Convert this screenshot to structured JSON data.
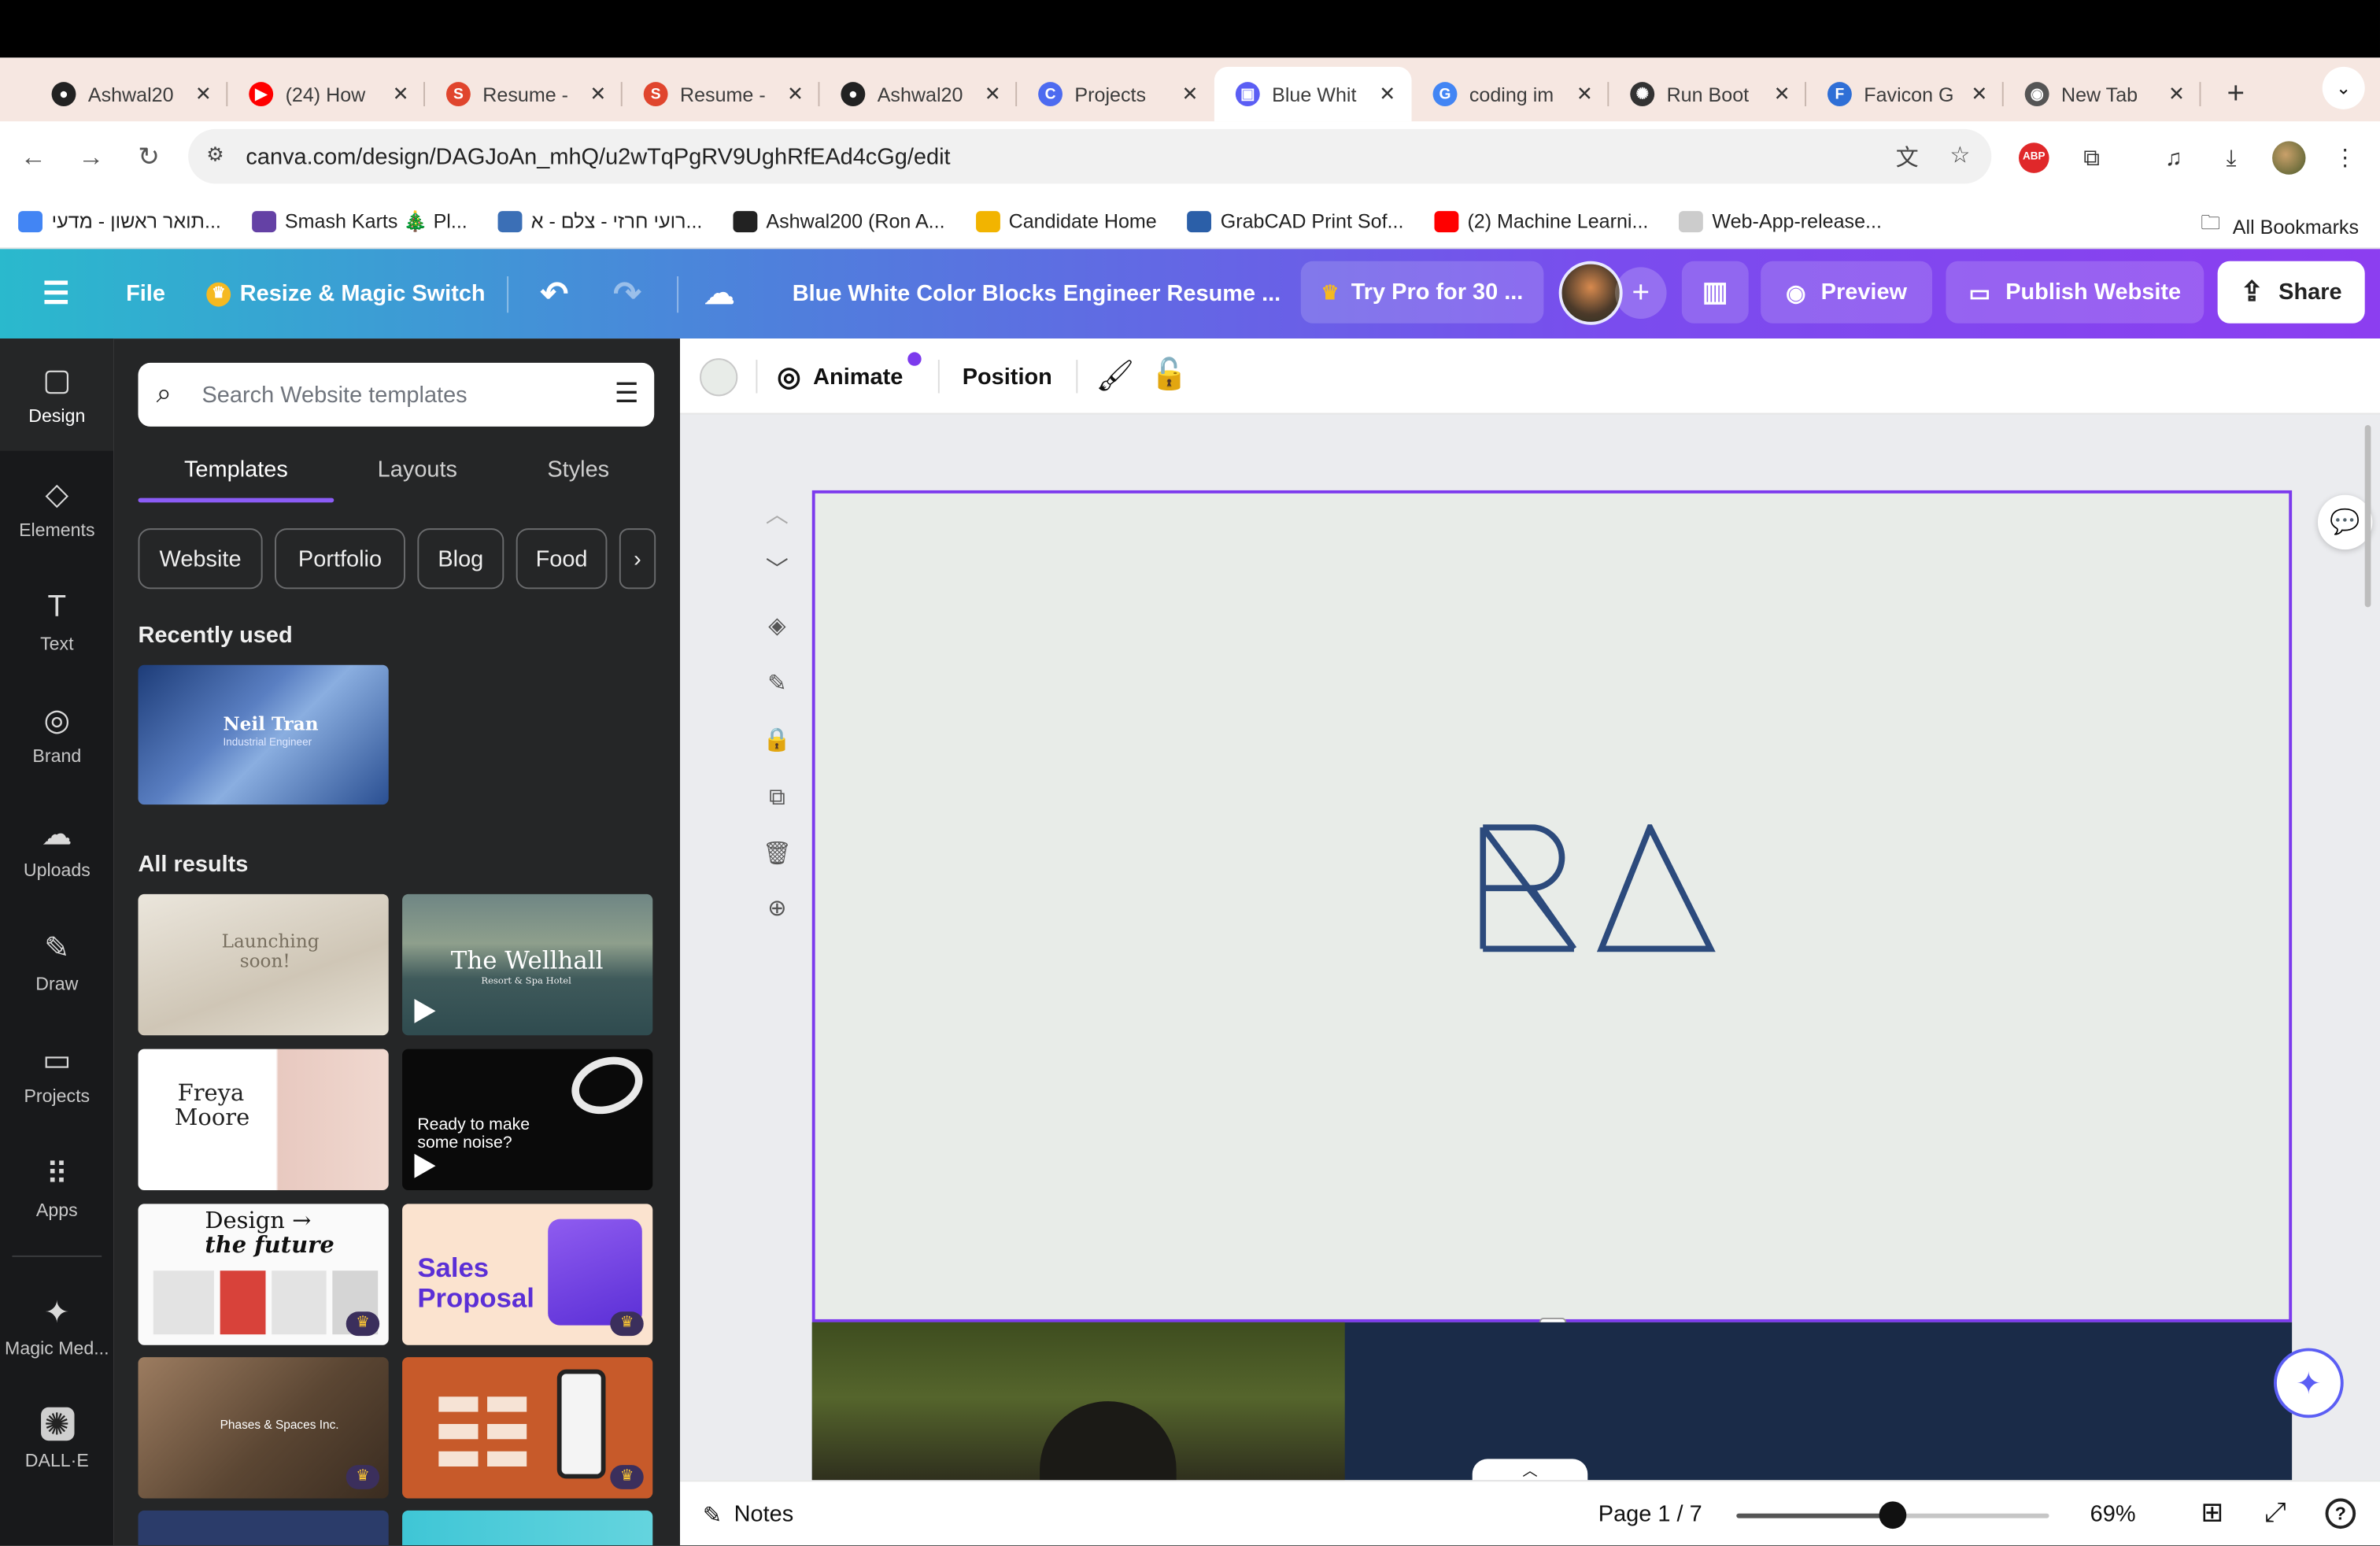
{
  "browser": {
    "tabs": [
      {
        "title": "Ashwal20",
        "favicon": "github-icon",
        "color": "#222222",
        "glyph": "●"
      },
      {
        "title": "(24) How",
        "favicon": "youtube-icon",
        "color": "#ff0000",
        "glyph": "▶"
      },
      {
        "title": "Resume -",
        "favicon": "resume-s-icon",
        "color": "#e0452d",
        "glyph": "S"
      },
      {
        "title": "Resume -",
        "favicon": "resume-s-icon",
        "color": "#e0452d",
        "glyph": "S"
      },
      {
        "title": "Ashwal20",
        "favicon": "github-icon",
        "color": "#222222",
        "glyph": "●"
      },
      {
        "title": "Projects",
        "favicon": "canva-icon",
        "color": "#4d6bf0",
        "glyph": "C"
      },
      {
        "title": "Blue Whit",
        "favicon": "canva-site-icon",
        "color": "#5b5ef4",
        "glyph": "▣"
      },
      {
        "title": "coding im",
        "favicon": "google-icon",
        "color": "#4285f4",
        "glyph": "G"
      },
      {
        "title": "Run Boot",
        "favicon": "openai-icon",
        "color": "#333333",
        "glyph": "✺"
      },
      {
        "title": "Favicon G",
        "favicon": "favicon-f-icon",
        "color": "#2f6fd6",
        "glyph": "F"
      },
      {
        "title": "New Tab",
        "favicon": "chrome-icon",
        "color": "#555555",
        "glyph": "◉"
      }
    ],
    "active_tab": 6,
    "new_tab": "+",
    "tab_menu": "⌄",
    "url": "canva.com/design/DAGJoAn_mhQ/u2wTqPgRV9UghRfEAd4cGg/edit",
    "bookmarks": [
      {
        "label": "תואר ראשון - מדעי...",
        "color": "#4285f4"
      },
      {
        "label": "Smash Karts 🎄 Pl...",
        "color": "#6441a5"
      },
      {
        "label": "רועי חרזי - צלם - א...",
        "color": "#3b6fb6"
      },
      {
        "label": "Ashwal200 (Ron A...",
        "color": "#222222"
      },
      {
        "label": "Candidate Home",
        "color": "#f2b400"
      },
      {
        "label": "GrabCAD Print Sof...",
        "color": "#2b5fa8"
      },
      {
        "label": "(2) Machine Learni...",
        "color": "#ff0000"
      },
      {
        "label": "Web-App-release...",
        "color": "#cccccc"
      }
    ],
    "all_bookmarks": "All Bookmarks"
  },
  "header": {
    "file": "File",
    "resize": "Resize & Magic Switch",
    "doc_title": "Blue White Color Blocks Engineer Resume ...",
    "try_pro": "Try Pro for 30 ...",
    "preview": "Preview",
    "publish": "Publish Website",
    "share": "Share"
  },
  "rail": [
    {
      "label": "Design",
      "icon": "design-icon",
      "glyph": "▢"
    },
    {
      "label": "Elements",
      "icon": "elements-icon",
      "glyph": "◇"
    },
    {
      "label": "Text",
      "icon": "text-icon",
      "glyph": "T"
    },
    {
      "label": "Brand",
      "icon": "brand-icon",
      "glyph": "◎"
    },
    {
      "label": "Uploads",
      "icon": "uploads-icon",
      "glyph": "☁"
    },
    {
      "label": "Draw",
      "icon": "draw-icon",
      "glyph": "✎"
    },
    {
      "label": "Projects",
      "icon": "projects-icon",
      "glyph": "▭"
    },
    {
      "label": "Apps",
      "icon": "apps-icon",
      "glyph": "⠿"
    },
    {
      "label": "Magic Med...",
      "icon": "magic-media-icon",
      "glyph": "✦"
    },
    {
      "label": "DALL·E",
      "icon": "dalle-icon",
      "glyph": "✺"
    }
  ],
  "panel": {
    "search_placeholder": "Search Website templates",
    "tabs": [
      "Templates",
      "Layouts",
      "Styles"
    ],
    "chips": [
      "Website",
      "Portfolio",
      "Blog",
      "Food"
    ],
    "recently_used": "Recently used",
    "recent": {
      "name": "Neil Tran",
      "role": "Industrial Engineer"
    },
    "all_results": "All results",
    "templates": [
      {
        "line1": "Launching",
        "line2": "soon!"
      },
      {
        "line1": "The Wellhall",
        "line2": "Resort & Spa Hotel"
      },
      {
        "line1": "Freya",
        "line2": "Moore"
      },
      {
        "line1": "Ready to make",
        "line2": "some noise?"
      },
      {
        "line1": "Design →",
        "line2": "the future"
      },
      {
        "line1": "Sales",
        "line2": "Proposal"
      },
      {
        "line1": "Phases & Spaces Inc.",
        "line2": ""
      },
      {
        "line1": "",
        "line2": ""
      }
    ]
  },
  "toolbar": {
    "animate": "Animate",
    "position": "Position"
  },
  "canvas": {
    "monogram": "RA",
    "logo_color": "#2c4a7c"
  },
  "footer": {
    "notes": "Notes",
    "page": "Page 1 / 7",
    "zoom": "69%",
    "zoom_fraction": 0.5
  }
}
